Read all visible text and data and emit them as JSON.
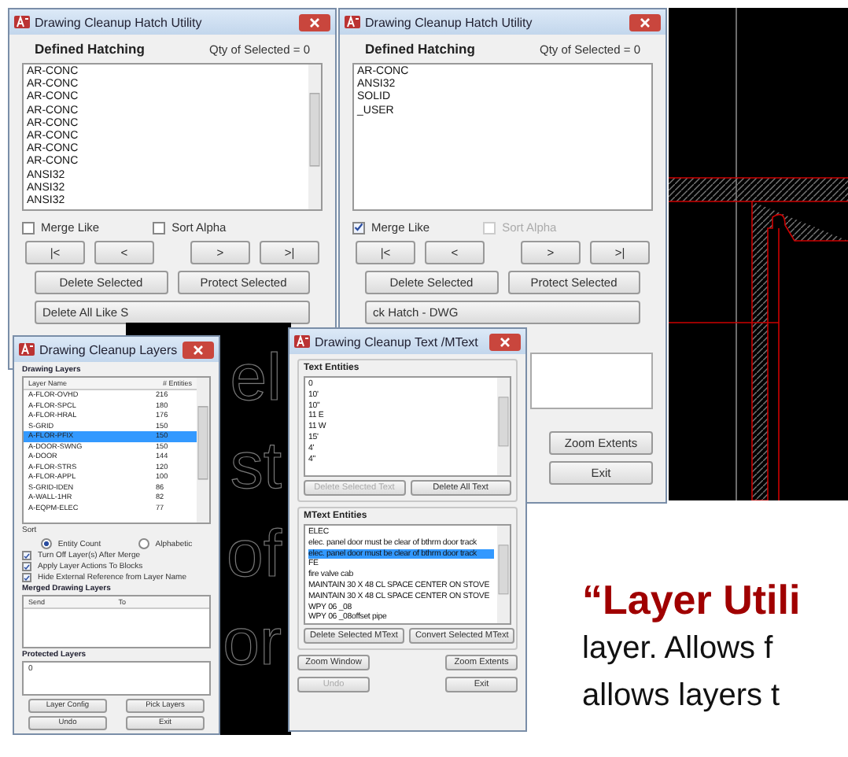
{
  "hatch_windows": [
    {
      "title": "Drawing Cleanup Hatch Utility",
      "heading": "Defined Hatching",
      "qty": "Qty of Selected = 0",
      "items": [
        {
          "text": "AR-CONC",
          "selected": false
        },
        {
          "text": "AR-CONC",
          "selected": false
        },
        {
          "text": "AR-CONC",
          "selected": false
        },
        {
          "text": "AR-CONC",
          "selected": false
        },
        {
          "text": "AR-CONC",
          "selected": false
        },
        {
          "text": "AR-CONC",
          "selected": false
        },
        {
          "text": "AR-CONC",
          "selected": false
        },
        {
          "text": "AR-CONC",
          "selected": false
        },
        {
          "text": "ANSI32",
          "selected": false
        },
        {
          "text": "ANSI32",
          "selected": false
        },
        {
          "text": "ANSI32",
          "selected": false
        }
      ],
      "scrollbar": true,
      "checkboxes": [
        {
          "label": "Merge Like",
          "checked": false,
          "disabled": false
        },
        {
          "label": "Sort Alpha",
          "checked": false,
          "disabled": false
        }
      ],
      "nav": [
        "|<",
        "<",
        ">",
        ">|"
      ],
      "buttons": [
        "Delete Selected",
        "Protect Selected"
      ],
      "partial_buttons": [
        "Delete All Like S"
      ]
    },
    {
      "title": "Drawing Cleanup Hatch Utility",
      "heading": "Defined Hatching",
      "qty": "Qty of Selected = 0",
      "items": [
        {
          "text": "AR-CONC",
          "selected": false
        },
        {
          "text": "ANSI32",
          "selected": false
        },
        {
          "text": "SOLID",
          "selected": false
        },
        {
          "text": "_USER",
          "selected": false
        }
      ],
      "scrollbar": false,
      "checkboxes": [
        {
          "label": "Merge Like",
          "checked": true,
          "disabled": false
        },
        {
          "label": "Sort Alpha",
          "checked": false,
          "disabled": true
        }
      ],
      "nav": [
        "|<",
        "<",
        ">",
        ">|"
      ],
      "buttons": [
        "Delete Selected",
        "Protect Selected"
      ],
      "partial_buttons": [
        "ck Hatch - DWG"
      ],
      "extra_buttons": [
        "Zoom Extents",
        "Exit"
      ]
    }
  ],
  "ghost_text": [
    "el",
    "st",
    "of",
    "or"
  ],
  "layer_dialog": {
    "title": "Drawing Cleanup Layers",
    "heading": "Drawing Layers",
    "columns": [
      "Layer Name",
      "# Entities"
    ],
    "rows": [
      {
        "name": "A-FLOR-OVHD",
        "count": "216",
        "selected": false
      },
      {
        "name": "A-FLOR-SPCL",
        "count": "180",
        "selected": false
      },
      {
        "name": "A-FLOR-HRAL",
        "count": "176",
        "selected": false
      },
      {
        "name": "S-GRID",
        "count": "150",
        "selected": false
      },
      {
        "name": "A-FLOR-PFIX",
        "count": "150",
        "selected": true
      },
      {
        "name": "A-DOOR-SWNG",
        "count": "150",
        "selected": false
      },
      {
        "name": "A-DOOR",
        "count": "144",
        "selected": false
      },
      {
        "name": "A-FLOR-STRS",
        "count": "120",
        "selected": false
      },
      {
        "name": "A-FLOR-APPL",
        "count": "100",
        "selected": false
      },
      {
        "name": "S-GRID-IDEN",
        "count": "86",
        "selected": false
      },
      {
        "name": "A-WALL-1HR",
        "count": "82",
        "selected": false
      },
      {
        "name": "A-EQPM-ELEC",
        "count": "77",
        "selected": false
      }
    ],
    "sort_label": "Sort",
    "sort_options": [
      {
        "label": "Entity Count",
        "selected": true
      },
      {
        "label": "Alphabetic",
        "selected": false
      }
    ],
    "checkboxes": [
      {
        "label": "Turn Off Layer(s) After Merge",
        "checked": true
      },
      {
        "label": "Apply Layer Actions To Blocks",
        "checked": true
      },
      {
        "label": "Hide External Reference from Layer Name",
        "checked": true
      }
    ],
    "merged_heading": "Merged Drawing Layers",
    "merged_columns": [
      "Send",
      "To"
    ],
    "protected_heading": "Protected Layers",
    "protected_items": [
      "0"
    ],
    "buttons": [
      "Layer Config",
      "Pick Layers",
      "Undo",
      "Exit"
    ]
  },
  "text_dialog": {
    "title": "Drawing Cleanup Text /MText",
    "text_heading": "Text Entities",
    "text_items": [
      {
        "text": "0",
        "selected": false
      },
      {
        "text": "10'",
        "selected": false
      },
      {
        "text": "10\"",
        "selected": false
      },
      {
        "text": "11 E",
        "selected": false
      },
      {
        "text": "11 W",
        "selected": false
      },
      {
        "text": "15'",
        "selected": false
      },
      {
        "text": "4'",
        "selected": false
      },
      {
        "text": "4\"",
        "selected": false
      }
    ],
    "text_buttons": [
      {
        "label": "Delete Selected Text",
        "disabled": true
      },
      {
        "label": "Delete All Text",
        "disabled": false
      }
    ],
    "mtext_heading": "MText Entities",
    "mtext_items": [
      {
        "text": "ELEC",
        "selected": false
      },
      {
        "text": "elec. panel door must be clear of bthrm door track",
        "selected": false
      },
      {
        "text": "elec. panel door must be clear of bthrm door track",
        "selected": true
      },
      {
        "text": "FE",
        "selected": false
      },
      {
        "text": "fire valve cab",
        "selected": false
      },
      {
        "text": "MAINTAIN 30 X 48 CL SPACE CENTER ON STOVE",
        "selected": false
      },
      {
        "text": "MAINTAIN 30 X 48 CL SPACE CENTER ON STOVE",
        "selected": false
      },
      {
        "text": "WPY 06 _08",
        "selected": false
      },
      {
        "text": "WPY 06 _08offset pipe",
        "selected": false
      }
    ],
    "mtext_buttons": [
      {
        "label": "Delete Selected MText",
        "disabled": false
      },
      {
        "label": "Convert Selected MText",
        "disabled": false
      }
    ],
    "bottom_buttons": [
      {
        "label": "Zoom Window",
        "disabled": false
      },
      {
        "label": "Zoom Extents",
        "disabled": false
      },
      {
        "label": "Undo",
        "disabled": true
      },
      {
        "label": "Exit",
        "disabled": false
      }
    ]
  },
  "slide_text": {
    "heading": "“Layer Utili",
    "lines": [
      "layer. Allows f",
      "allows layers t"
    ]
  }
}
